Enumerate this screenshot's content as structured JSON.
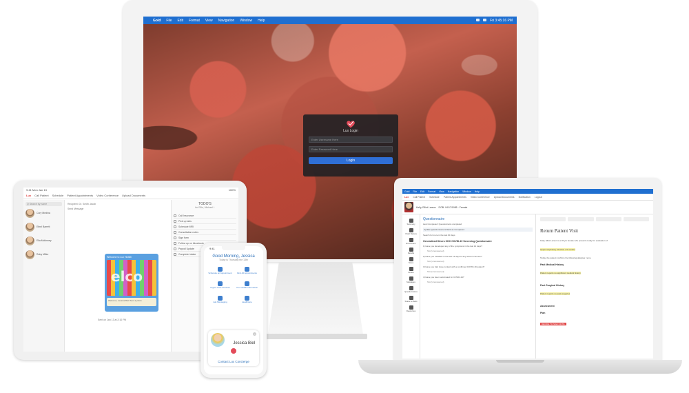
{
  "imac": {
    "menubar": {
      "app": "Gold",
      "items": [
        "File",
        "Edit",
        "Format",
        "View",
        "Navigation",
        "Window",
        "Help"
      ],
      "clock": "Fri 3:45:16 PM"
    },
    "login": {
      "title": "Lux Login",
      "username_placeholder": "Enter Username Here",
      "password_placeholder": "Enter Password Here",
      "button": "Login"
    }
  },
  "ipad": {
    "status": {
      "time": "9:41  Mon Jan 13",
      "battery": "100%"
    },
    "toolbar": {
      "logo": "Lux",
      "items": [
        "Call Patient",
        "Schedule",
        "Patient Appointments",
        "Video Conference",
        "Upload Documents"
      ]
    },
    "search_placeholder": "Q Search by name",
    "contacts": [
      "Cory Medina",
      "Ethel Barrett",
      "Ella Mckinney",
      "Ruby Miller"
    ],
    "chat_lines": [
      "Recipient: Dr. Smith Jacob",
      "Send Message",
      "Sent on Jan 13 at 2:10 PM"
    ],
    "chat_image": {
      "caption": "Welcome to Lux Health",
      "photo_text": "elco",
      "footnote": "Welcome, Jessica Biel! Sent a photo."
    },
    "todo": {
      "title": "TODO'S",
      "subtitle": "for Ellis, Michael I.",
      "items": [
        "Call Insurance",
        "Pick up labs",
        "Schedule MRI",
        "Consultation notes",
        "Sign form",
        "Follow up on bloodwork",
        "Payroll Update",
        "Complete intake"
      ]
    }
  },
  "phone": {
    "time": "9:41",
    "greeting": "Good Morning, Jessica",
    "date": "Today is Thursday the 13th",
    "tiles": [
      "Schedule an Appointment",
      "Find All Appointments",
      "Urgent Care Services",
      "Your Health Information",
      "Lab Messaging",
      "Healthcare"
    ],
    "card": {
      "name": "Jessica Biel",
      "contact": "Contact Lux Concierge",
      "close": "×"
    }
  },
  "laptop": {
    "menubar": [
      "Gold",
      "File",
      "Edit",
      "Format",
      "View",
      "Navigation",
      "Window",
      "Help"
    ],
    "toolbar": {
      "logo": "Lux",
      "items": [
        "Call Patient",
        "Schedule",
        "Patient Appointments",
        "Video Conference",
        "Upload Documents",
        "Notification",
        "Logout"
      ]
    },
    "patient": {
      "name": "Kelly, Elliot Larson",
      "info": "DOB: 04/17/1985 · Female"
    },
    "nav": [
      "Summary",
      "Chart Review",
      "Encounters",
      "Results",
      "Notes",
      "Orders",
      "Messages",
      "Questionnaires",
      "Scans & Meds",
      "Resources"
    ],
    "questionnaire": {
      "title": "Questionnaire",
      "lines": [
        "Last Completed: Questionnaire completed",
        "Search for more in the last 30 days"
      ],
      "highlight": "Update Questionnaire & Mark as Completed",
      "section": "Generalized Diners CDC COVID-19 Screening Questionnaire",
      "questions": [
        "1) Have you developed any of the symptoms in the last 14 days?",
        "2) Have you travelled in the last 14 days to any area of concern?",
        "3) Have you had close contact with a confirmed COVID-19 patient?",
        "4) Have you been vaccinated for COVID-19?"
      ],
      "answer": "N/A (Unanswered)"
    },
    "note": {
      "title": "Return Patient Visit",
      "lines": [
        "Kelly, Elliot Larson is a 36 y/o female who presents today for evaluation of",
        "Today, the patient confirms the following allergies: none"
      ],
      "hl1": "Upper respiratory infection x 5 months",
      "headings": [
        "Past Medical History",
        "Past Surgical History",
        "Assessment",
        "Plan"
      ],
      "hl2": "Patient reports no significant medical history",
      "hl3": "Patient reports no past surgeries",
      "plan": "DECIDE TO SIGN NOTE"
    }
  }
}
